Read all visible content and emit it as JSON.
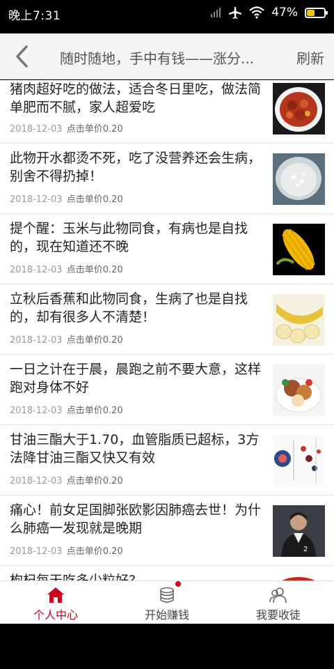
{
  "status_bar": {
    "time": "晚上7:31",
    "battery": "47%",
    "battery_level": 0.47
  },
  "nav": {
    "title": "随时随地，手中有钱——涨分...",
    "refresh": "刷新"
  },
  "items": [
    {
      "title": "猪肉超好吃的做法，适合冬日里吃，做法简单肥而不腻，家人超爱吃",
      "date": "2018-12-03",
      "price": "点击单价0.20",
      "thumb": "pork-dish"
    },
    {
      "title": "此物开水都烫不死，吃了没营养还会生病，别舍不得扔掉！",
      "date": "2018-12-03",
      "price": "点击单价0.20",
      "thumb": "rice-bowl"
    },
    {
      "title": "提个醒：玉米与此物同食，有病也是自找的，现在知道还不晚",
      "date": "2018-12-03",
      "price": "点击单价0.20",
      "thumb": "corn"
    },
    {
      "title": "立秋后香蕉和此物同食，生病了也是自找的，却有很多人不清楚！",
      "date": "2018-12-03",
      "price": "点击单价0.20",
      "thumb": "banana"
    },
    {
      "title": "一日之计在于晨，晨跑之前不要大意，这样跑对身体不好",
      "date": "2018-12-03",
      "price": "点击单价0.20",
      "thumb": "breakfast-plate"
    },
    {
      "title": "甘油三酯大于1.70，血管脂质已超标，3方法降甘油三酯又快又有效",
      "date": "2018-12-03",
      "price": "点击单价0.20",
      "thumb": "medical-chart"
    },
    {
      "title": "痛心！前女足国脚张欧影因肺癌去世！为什么肺癌一发现就是晚期",
      "date": "2018-12-03",
      "price": "点击单价0.20",
      "thumb": "football-player"
    },
    {
      "title": "枸杞每天吃多少粒好?",
      "date": "",
      "price": "",
      "thumb": "goji"
    }
  ],
  "tabs": [
    {
      "label": "个人中心",
      "icon": "home-icon",
      "active": true
    },
    {
      "label": "开始赚钱",
      "icon": "coins-icon",
      "active": false,
      "badge": true
    },
    {
      "label": "我要收徒",
      "icon": "users-icon",
      "active": false
    }
  ],
  "colors": {
    "accent": "#d0021b",
    "battery": "#f1c40f"
  }
}
